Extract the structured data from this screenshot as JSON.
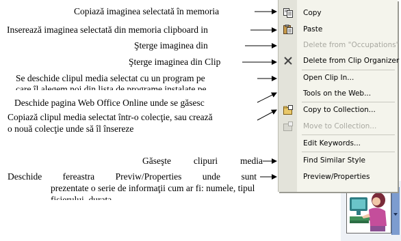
{
  "annotations": [
    "Copiază imaginea selectată în memoria",
    "Inserează imaginea selectată din memoria clipboard in",
    "Şterge imaginea din",
    "Şterge imaginea din Clip",
    "Se deschide clipul media selectat cu un program pe",
    "care îl alegem noi din lista de programe instalate pe",
    "Deschide pagina Web Office Online unde se găsesc",
    "Copiază clipul media selectat într-o colecţie, sau crează",
    "o nouă colecţie unde să îl însereze",
    "Găseşte clipuri media",
    "Deschide fereastra Previw/Properties unde sunt",
    "prezentate o serie de informaţii cum ar fi: numele, tipul",
    "fişierului, durata"
  ],
  "menu": {
    "items": [
      {
        "label": "Copy",
        "icon": "copy-icon",
        "enabled": true
      },
      {
        "label": "Paste",
        "icon": "paste-icon",
        "enabled": true
      },
      {
        "label": "Delete from \"Occupations\"",
        "icon": "",
        "enabled": false
      },
      {
        "label": "Delete from Clip Organizer",
        "icon": "delete-x-icon",
        "enabled": true
      },
      {
        "label": "Open Clip In...",
        "icon": "",
        "enabled": true
      },
      {
        "label": "Tools on the Web...",
        "icon": "",
        "enabled": true
      },
      {
        "label": "Copy to Collection...",
        "icon": "copy-to-collection-icon",
        "enabled": true
      },
      {
        "label": "Move to Collection...",
        "icon": "move-to-collection-icon",
        "enabled": false
      },
      {
        "label": "Edit Keywords...",
        "icon": "",
        "enabled": true
      },
      {
        "label": "Find Similar Style",
        "icon": "",
        "enabled": true
      },
      {
        "label": "Preview/Properties",
        "icon": "",
        "enabled": true
      }
    ]
  },
  "thumbnail": {
    "icon": "clipart-woman-at-computer-icon"
  }
}
